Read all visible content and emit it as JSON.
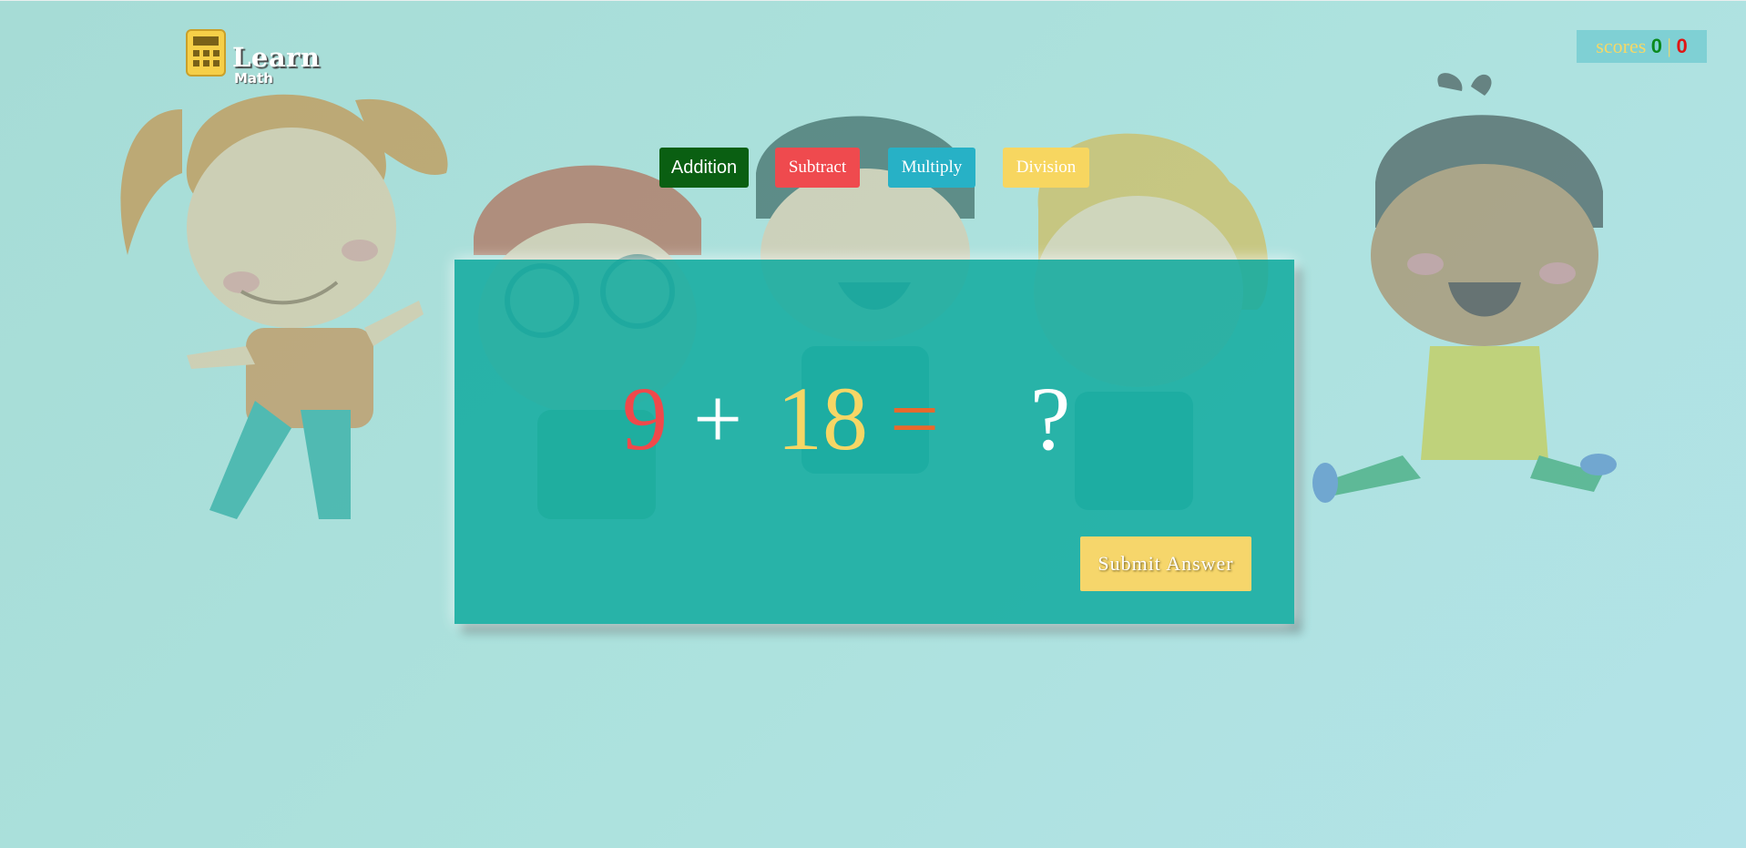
{
  "logo": {
    "title": "Learn",
    "subtitle": "Math"
  },
  "scores": {
    "label": "scores",
    "correct": "0",
    "separator": "|",
    "wrong": "0"
  },
  "operations": {
    "addition": "Addition",
    "subtract": "Subtract",
    "multiply": "Multiply",
    "division": "Division",
    "active": "Addition"
  },
  "question": {
    "operand1": "9",
    "operator": "+",
    "operand2": "18",
    "equals": "=",
    "answer_placeholder": "?"
  },
  "submit_label": "Submit Answer",
  "colors": {
    "background": "#ade2de",
    "card": "#16aca0",
    "addition": "#0a5f12",
    "subtract": "#ef4a4e",
    "multiply": "#27b1c6",
    "division": "#f7d660",
    "accent": "#f6d66b"
  },
  "icons": {
    "logo": "calculator-icon"
  }
}
